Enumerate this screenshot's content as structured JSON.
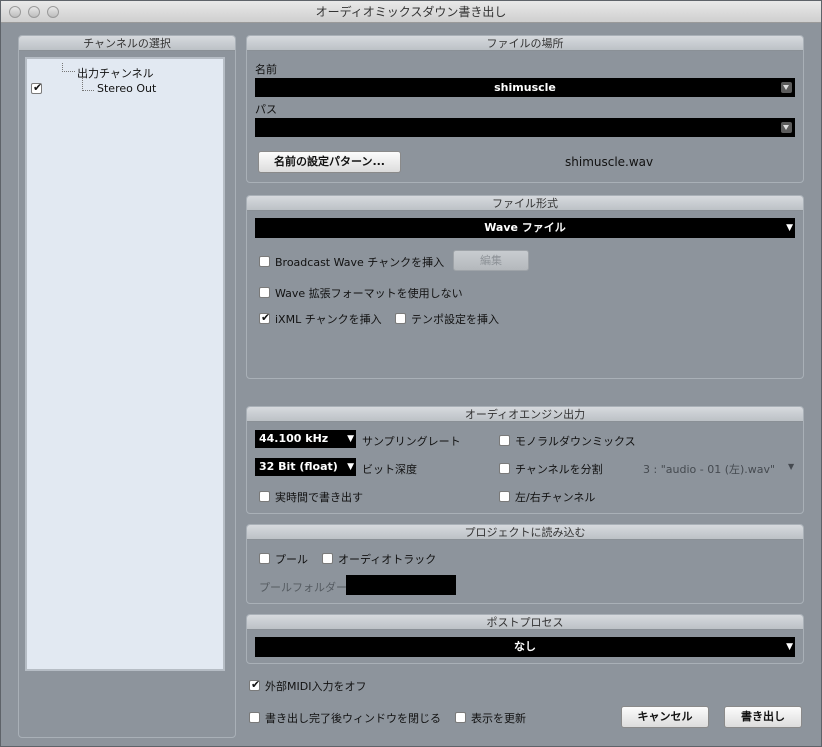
{
  "window": {
    "title": "オーディオミックスダウン書き出し"
  },
  "channels": {
    "header": "チャンネルの選択",
    "root": "出力チャンネル",
    "child": "Stereo Out",
    "child_checked": true
  },
  "file_location": {
    "header": "ファイルの場所",
    "name_label": "名前",
    "name_value": "shimuscle",
    "path_label": "パス",
    "path_value": "",
    "naming_button": "名前の設定パターン...",
    "filename": "shimuscle.wav"
  },
  "file_format": {
    "header": "ファイル形式",
    "format_value": "Wave ファイル",
    "bwf_label": "Broadcast Wave チャンクを挿入",
    "bwf_checked": false,
    "edit_button": "編集",
    "ext_label": "Wave 拡張フォーマットを使用しない",
    "ext_checked": false,
    "ixml_label": "iXML チャンクを挿入",
    "ixml_checked": true,
    "tempo_label": "テンポ設定を挿入",
    "tempo_checked": false
  },
  "audio_engine": {
    "header": "オーディオエンジン出力",
    "sample_rate_value": "44.100 kHz",
    "sample_rate_label": "サンプリングレート",
    "bit_depth_value": "32 Bit (float)",
    "bit_depth_label": "ビット深度",
    "realtime_label": "実時間で書き出す",
    "realtime_checked": false,
    "mono_label": "モノラルダウンミックス",
    "mono_checked": false,
    "split_label": "チャンネルを分割",
    "split_checked": false,
    "split_preview": "3 : \"audio - 01 (左).wav\"",
    "lr_label": "左/右チャンネル",
    "lr_checked": false
  },
  "import_project": {
    "header": "プロジェクトに読み込む",
    "pool_label": "プール",
    "pool_checked": false,
    "audio_track_label": "オーディオトラック",
    "audio_track_checked": false,
    "pool_folder_label": "プールフォルダー",
    "pool_folder_value": ""
  },
  "post_process": {
    "header": "ポストプロセス",
    "value": "なし"
  },
  "footer": {
    "midi_off_label": "外部MIDI入力をオフ",
    "midi_off_checked": true,
    "close_after_label": "書き出し完了後ウィンドウを閉じる",
    "close_after_checked": false,
    "refresh_label": "表示を更新",
    "refresh_checked": false,
    "cancel_button": "キャンセル",
    "export_button": "書き出し"
  }
}
